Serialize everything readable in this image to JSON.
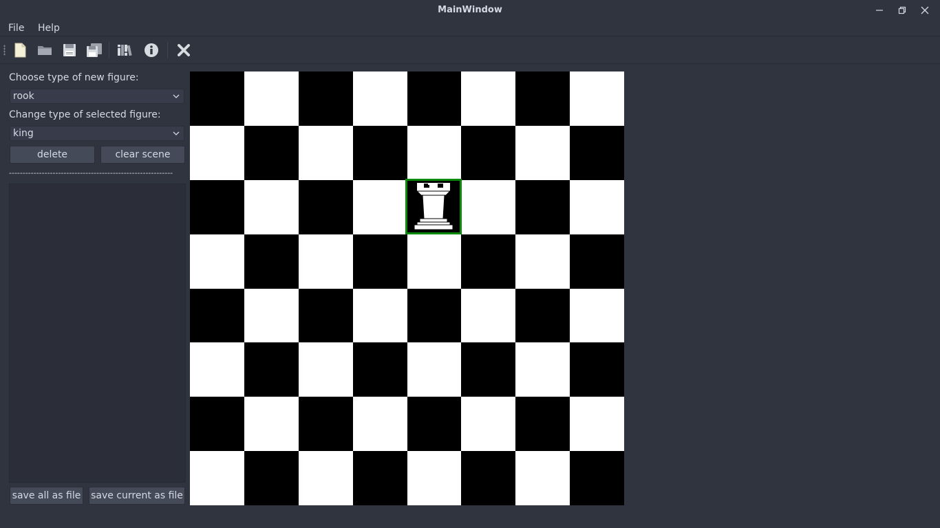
{
  "window": {
    "title": "MainWindow",
    "controls": [
      "minimize-icon",
      "restore-icon",
      "close-icon"
    ]
  },
  "menubar": {
    "items": [
      {
        "label": "File"
      },
      {
        "label": "Help"
      }
    ]
  },
  "toolbar": {
    "tools": [
      {
        "icon": "new-file-icon"
      },
      {
        "icon": "open-folder-icon"
      },
      {
        "icon": "save-icon"
      },
      {
        "icon": "save-all-icon"
      },
      {
        "icon": "library-icon"
      },
      {
        "icon": "info-icon"
      },
      {
        "icon": "close-x-icon"
      }
    ]
  },
  "sidebar": {
    "new_figure_label": "Choose type of new figure:",
    "new_figure_value": "rook",
    "change_figure_label": "Change type of selected figure:",
    "change_figure_value": "king",
    "delete_label": "delete",
    "clear_label": "clear scene",
    "separator": "------------------------------------------------------------",
    "save_all_label": "save all as file",
    "save_current_label": "save current as file"
  },
  "board": {
    "size": 8,
    "colors": {
      "dark": "#000000",
      "light": "#ffffff",
      "selection": "#0b8a0b"
    },
    "pieces": [
      {
        "type": "rook",
        "color": "white",
        "row": 2,
        "col": 4,
        "selected": true
      }
    ]
  }
}
